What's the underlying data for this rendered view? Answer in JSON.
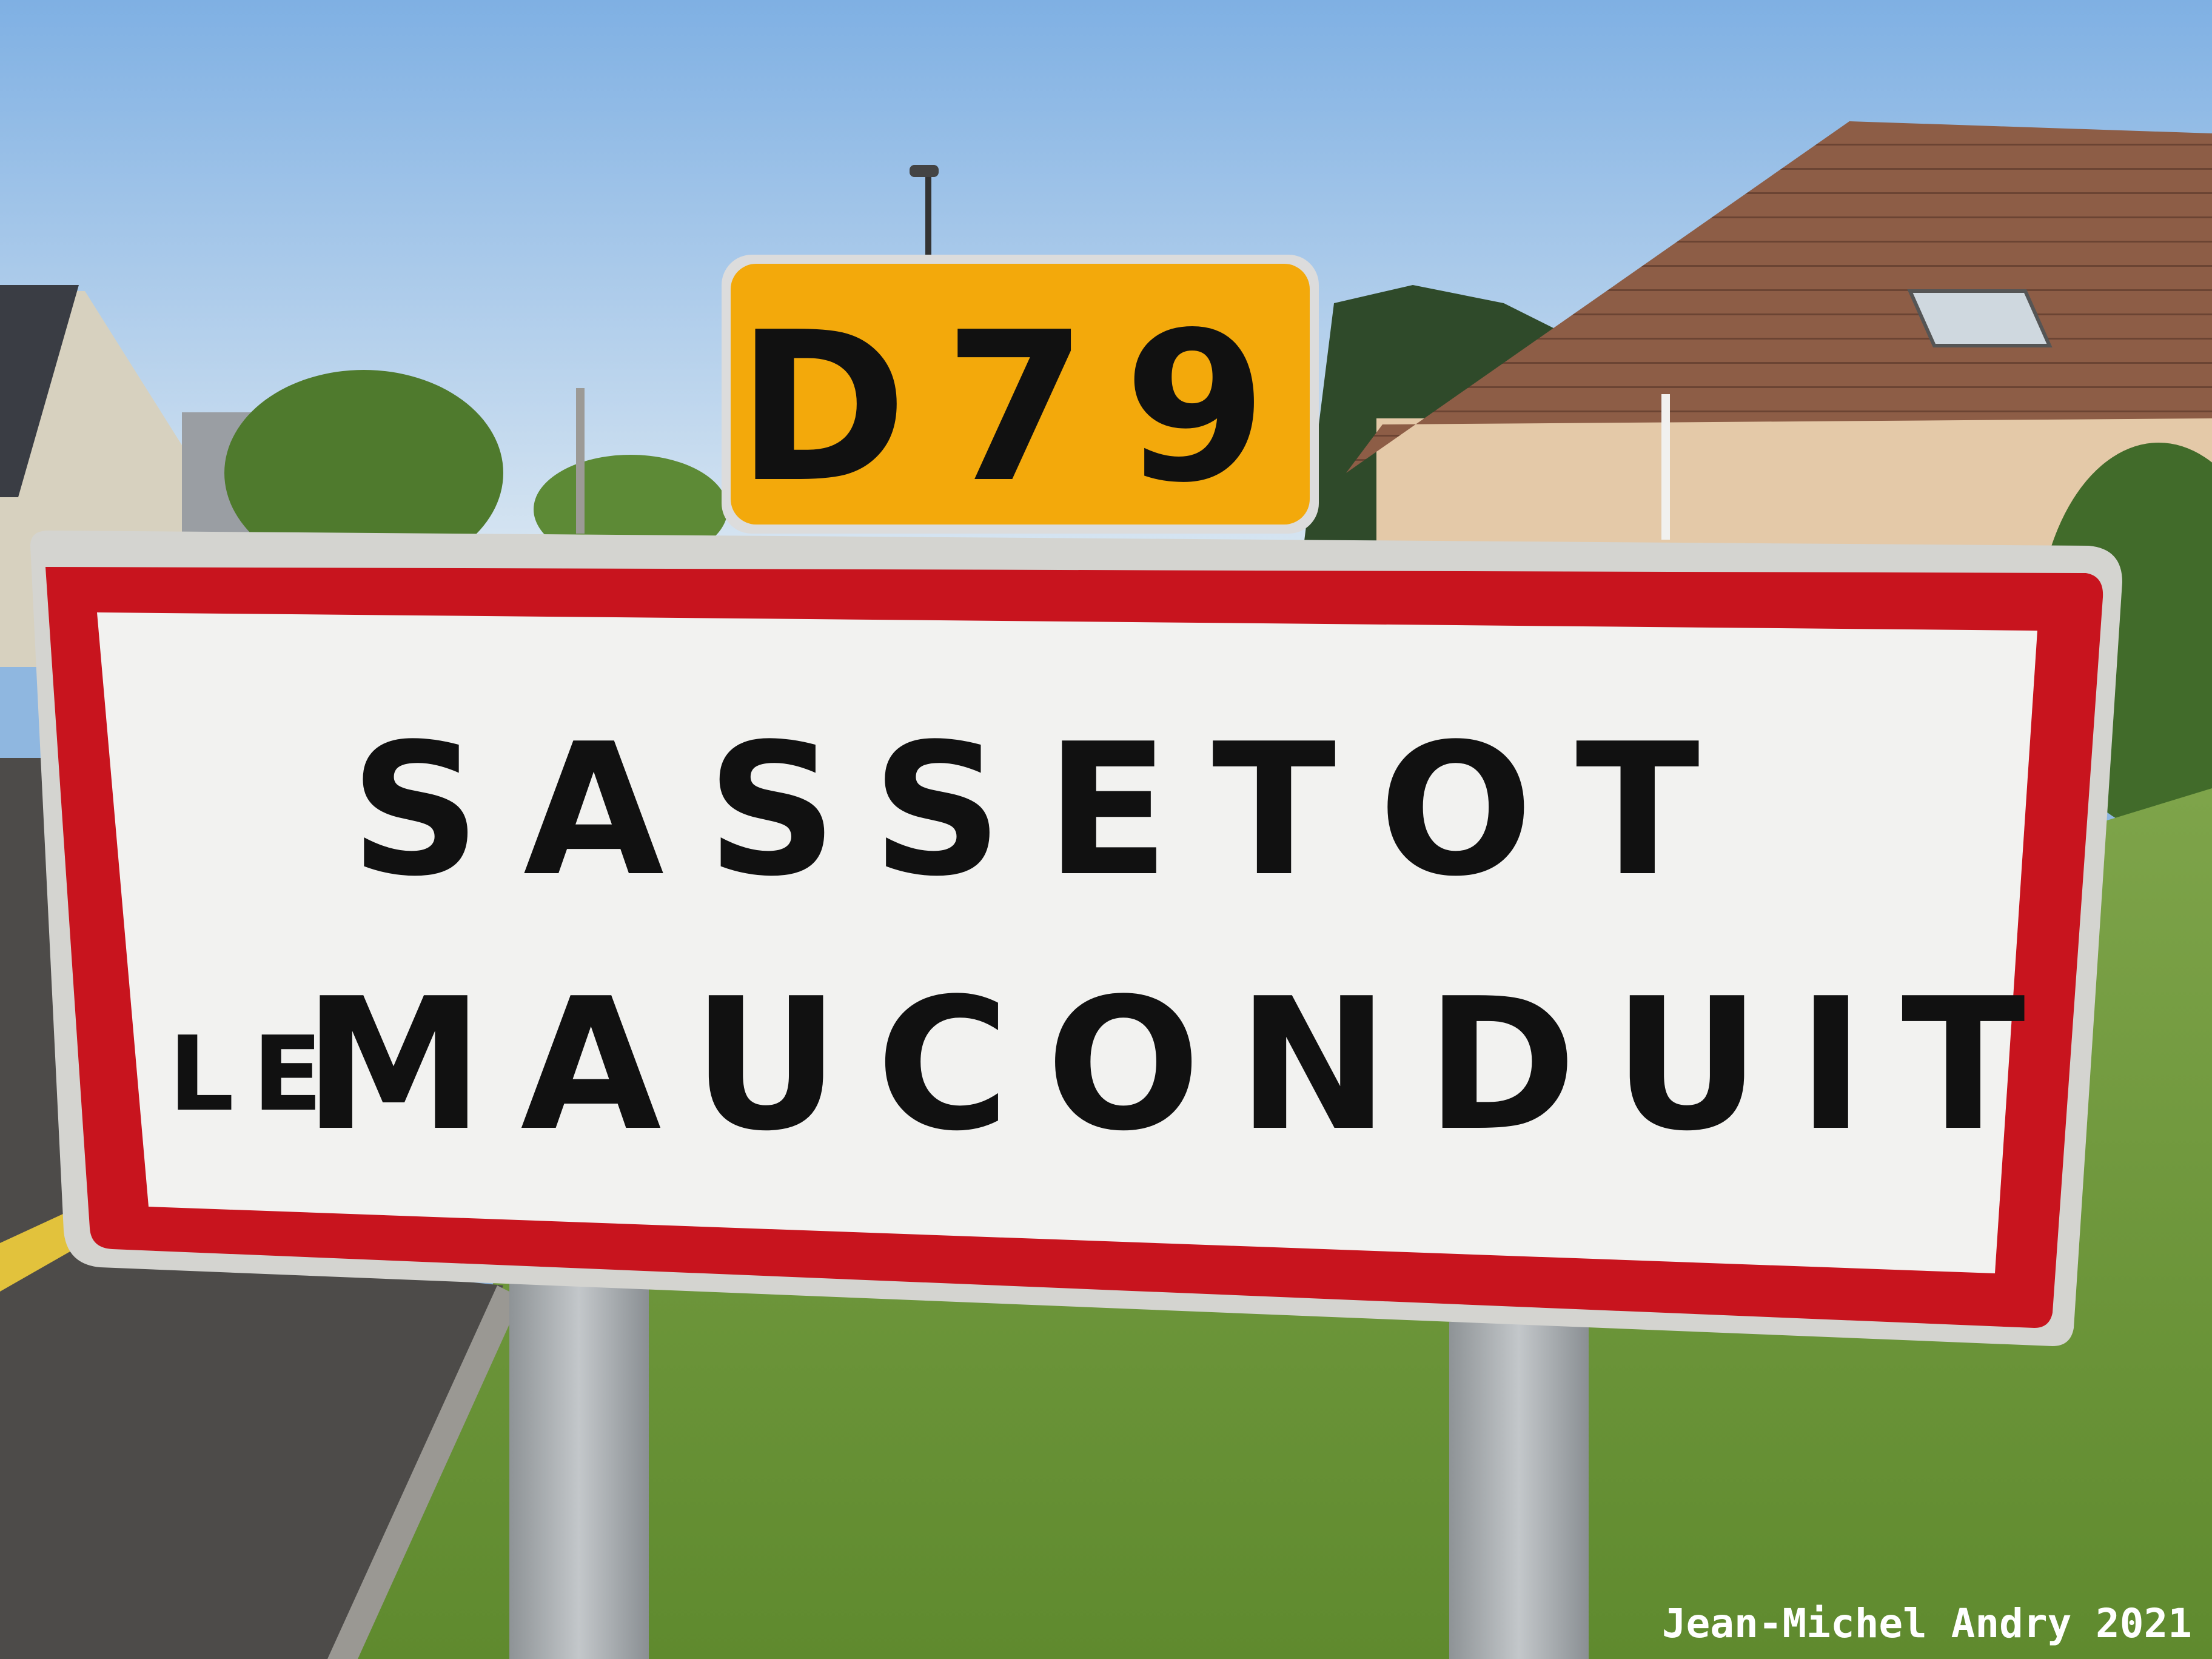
{
  "route_plate": {
    "text": "D79",
    "background_color": "#f3a90b",
    "text_color": "#151515"
  },
  "place_sign": {
    "line1": "SASSETOT",
    "line2_prefix": "LE",
    "line2_main": "MAUCONDUIT",
    "border_color": "#c8141e",
    "background_color": "#f2f2f0",
    "text_color": "#111111"
  },
  "photo_credit": "Jean-Michel Andry 2021",
  "palette": {
    "sky_top": "#7fb0e3",
    "sky_bottom": "#d9e8f4",
    "grass": "#6f9a3a",
    "road": "#4d4b49",
    "roof": "#8a5a44",
    "wall": "#e4c9a8",
    "post": "#a8acaf"
  }
}
